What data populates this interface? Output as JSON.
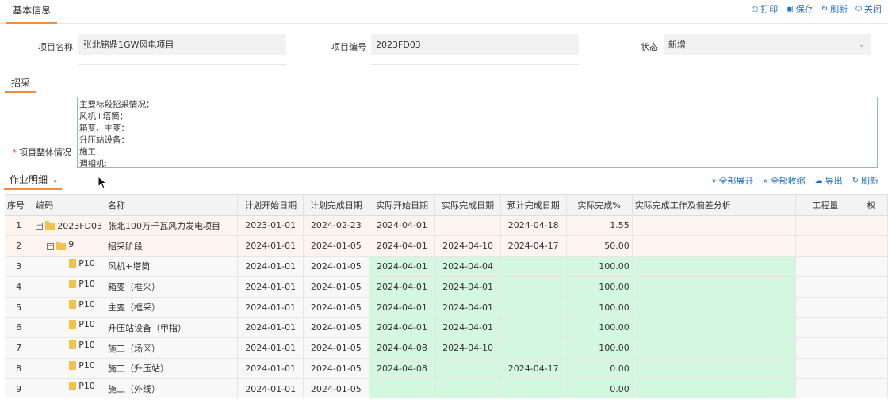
{
  "header": {
    "tab_label": "基本信息",
    "actions": [
      {
        "icon": "print-icon",
        "glyph": "⎙",
        "label": "打印"
      },
      {
        "icon": "save-icon",
        "glyph": "▣",
        "label": "保存"
      },
      {
        "icon": "refresh-icon",
        "glyph": "↻",
        "label": "刷新"
      },
      {
        "icon": "power-icon",
        "glyph": "⏻",
        "label": "关闭"
      }
    ]
  },
  "form": {
    "project_name_label": "项目名称",
    "project_name_value": "张北铭鼎1GW风电项目",
    "project_code_label": "项目编号",
    "project_code_value": "2023FD03",
    "status_label": "状态",
    "status_value": "新增"
  },
  "procurement": {
    "section_title": "招采",
    "overall_label": "项目整体情况",
    "overall_text": "主要标段招采情况：\n风机+塔筒：\n箱变、主变：\n升压站设备：\n施工：\n调相机:"
  },
  "grid": {
    "title": "作业明细",
    "title_chevron": "»",
    "actions": [
      {
        "icon": "expand-all-icon",
        "glyph": "»",
        "label": "全部展开"
      },
      {
        "icon": "collapse-all-icon",
        "glyph": "«",
        "label": "全部收缩"
      },
      {
        "icon": "cloud-download-icon",
        "glyph": "☁",
        "label": "导出"
      },
      {
        "icon": "refresh-icon",
        "glyph": "↻",
        "label": "刷新"
      }
    ],
    "columns": [
      "序号",
      "编码",
      "名称",
      "计划开始日期",
      "计划完成日期",
      "实际开始日期",
      "实际完成日期",
      "预计完成日期",
      "实际完成%",
      "实际完成工作及偏差分析",
      "工程量",
      "权"
    ],
    "rows": [
      {
        "idx": "1",
        "level": 0,
        "type": "folder",
        "code": "2023FD03",
        "name": "张北100万千瓦风力发电项目",
        "plan_start": "2023-01-01",
        "plan_end": "2024-02-23",
        "act_start": "2024-04-01",
        "act_end": "",
        "est_end": "2024-04-18",
        "pct": "1.55",
        "style": "pink"
      },
      {
        "idx": "2",
        "level": 1,
        "type": "folder",
        "code": "9",
        "name": "招采阶段",
        "plan_start": "2024-01-01",
        "plan_end": "2024-01-05",
        "act_start": "2024-04-01",
        "act_end": "2024-04-10",
        "est_end": "2024-04-17",
        "pct": "50.00",
        "style": "pink"
      },
      {
        "idx": "3",
        "level": 2,
        "type": "file",
        "code": "P10",
        "name": "风机+塔筒",
        "plan_start": "2024-01-01",
        "plan_end": "2024-01-05",
        "act_start": "2024-04-01",
        "act_end": "2024-04-04",
        "est_end": "",
        "pct": "100.00",
        "style": "plain"
      },
      {
        "idx": "4",
        "level": 2,
        "type": "file",
        "code": "P10",
        "name": "箱变（框采）",
        "plan_start": "2024-01-01",
        "plan_end": "2024-01-05",
        "act_start": "2024-04-01",
        "act_end": "2024-04-01",
        "est_end": "",
        "pct": "100.00",
        "style": "plain"
      },
      {
        "idx": "5",
        "level": 2,
        "type": "file",
        "code": "P10",
        "name": "主变（框采）",
        "plan_start": "2024-01-01",
        "plan_end": "2024-01-05",
        "act_start": "2024-04-01",
        "act_end": "2024-04-01",
        "est_end": "",
        "pct": "100.00",
        "style": "plain"
      },
      {
        "idx": "6",
        "level": 2,
        "type": "file",
        "code": "P10",
        "name": "升压站设备（甲指）",
        "plan_start": "2024-01-01",
        "plan_end": "2024-01-05",
        "act_start": "2024-04-01",
        "act_end": "2024-04-01",
        "est_end": "",
        "pct": "100.00",
        "style": "plain"
      },
      {
        "idx": "7",
        "level": 2,
        "type": "file",
        "code": "P10",
        "name": "施工（场区）",
        "plan_start": "2024-01-01",
        "plan_end": "2024-01-05",
        "act_start": "2024-04-08",
        "act_end": "2024-04-10",
        "est_end": "",
        "pct": "100.00",
        "style": "plain"
      },
      {
        "idx": "8",
        "level": 2,
        "type": "file",
        "code": "P10",
        "name": "施工（升压站）",
        "plan_start": "2024-01-01",
        "plan_end": "2024-01-05",
        "act_start": "2024-04-08",
        "act_end": "",
        "est_end": "2024-04-17",
        "pct": "0.00",
        "style": "plain"
      },
      {
        "idx": "9",
        "level": 2,
        "type": "file",
        "code": "P10",
        "name": "施工（外线）",
        "plan_start": "2024-01-01",
        "plan_end": "2024-01-05",
        "act_start": "",
        "act_end": "",
        "est_end": "",
        "pct": "0.00",
        "style": "plain"
      }
    ]
  },
  "colors": {
    "accent": "#f08c3c",
    "link": "#1f6fc5",
    "green_cell": "#d4f7e0",
    "pink_row": "#fdf3ef"
  }
}
